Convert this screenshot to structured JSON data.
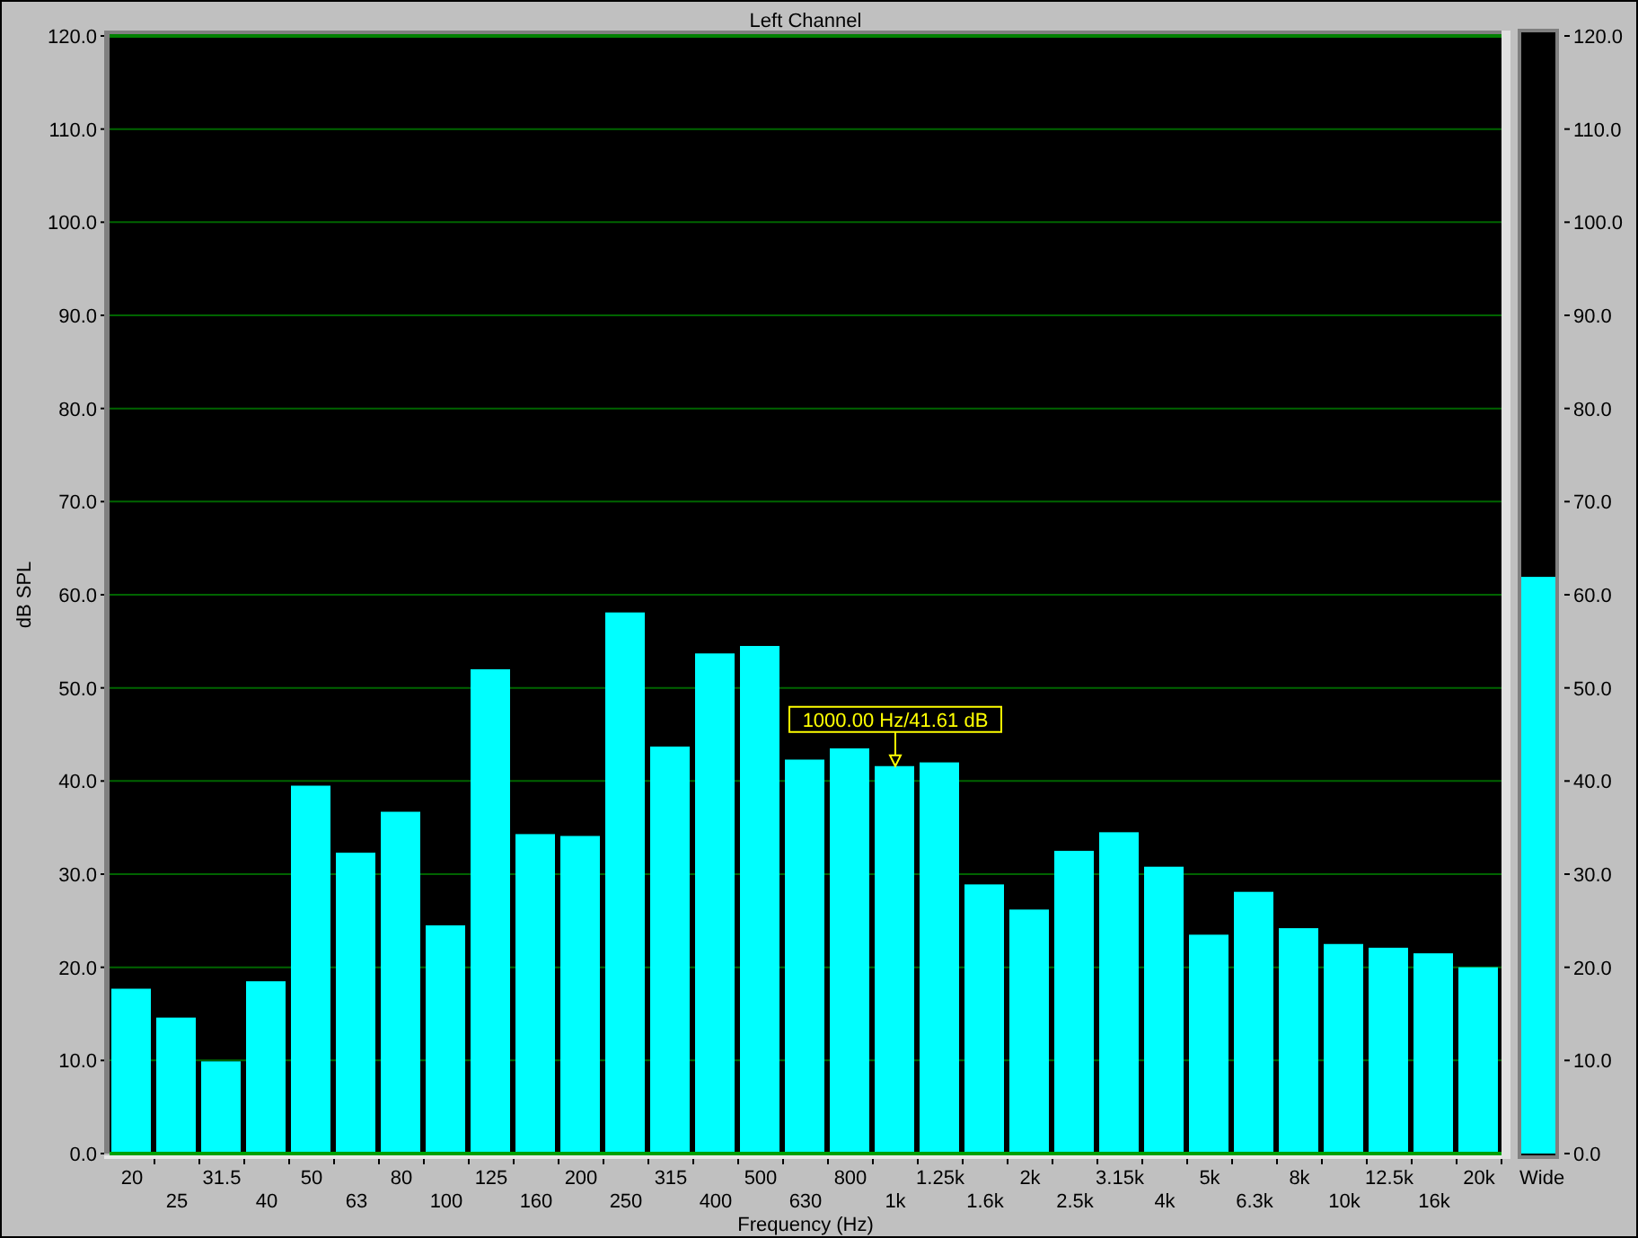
{
  "chart_data": {
    "type": "bar",
    "title": "Left Channel",
    "xlabel": "Frequency (Hz)",
    "ylabel": "dB SPL",
    "categories": [
      "20",
      "25",
      "31.5",
      "40",
      "50",
      "63",
      "80",
      "100",
      "125",
      "160",
      "200",
      "250",
      "315",
      "400",
      "500",
      "630",
      "800",
      "1k",
      "1.25k",
      "1.6k",
      "2k",
      "2.5k",
      "3.15k",
      "4k",
      "5k",
      "6.3k",
      "8k",
      "10k",
      "12.5k",
      "16k",
      "20k"
    ],
    "series": [
      {
        "color": "#00ffff",
        "values": [
          17.7,
          14.6,
          9.9,
          18.5,
          39.5,
          32.3,
          36.7,
          24.5,
          52.0,
          34.3,
          34.1,
          58.1,
          43.7,
          53.7,
          54.5,
          42.3,
          43.5,
          41.6,
          42.0,
          28.9,
          26.2,
          32.5,
          34.5,
          30.8,
          23.5,
          28.1,
          24.2,
          22.5,
          22.1,
          21.5,
          20.0
        ]
      }
    ],
    "ylim": [
      0,
      120
    ],
    "yticks": [
      {
        "value": 0,
        "label": "0.0"
      },
      {
        "value": 10,
        "label": "10.0"
      },
      {
        "value": 20,
        "label": "20.0"
      },
      {
        "value": 30,
        "label": "30.0"
      },
      {
        "value": 40,
        "label": "40.0"
      },
      {
        "value": 50,
        "label": "50.0"
      },
      {
        "value": 60,
        "label": "60.0"
      },
      {
        "value": 70,
        "label": "70.0"
      },
      {
        "value": 80,
        "label": "80.0"
      },
      {
        "value": 90,
        "label": "90.0"
      },
      {
        "value": 100,
        "label": "100.0"
      },
      {
        "value": 110,
        "label": "110.0"
      },
      {
        "value": 120,
        "label": "120.0"
      }
    ],
    "grid": true,
    "annotations": [
      {
        "text": "1000.00 Hz/41.61 dB",
        "x": "1k",
        "y": 41.6
      }
    ]
  },
  "meter": {
    "label": "Wide",
    "level": 0.516,
    "ticks": [
      "120.0",
      "110.0",
      "100.0",
      "90.0",
      "80.0",
      "70.0",
      "60.0",
      "50.0",
      "40.0",
      "30.0",
      "20.0",
      "10.0",
      "0.0"
    ]
  }
}
